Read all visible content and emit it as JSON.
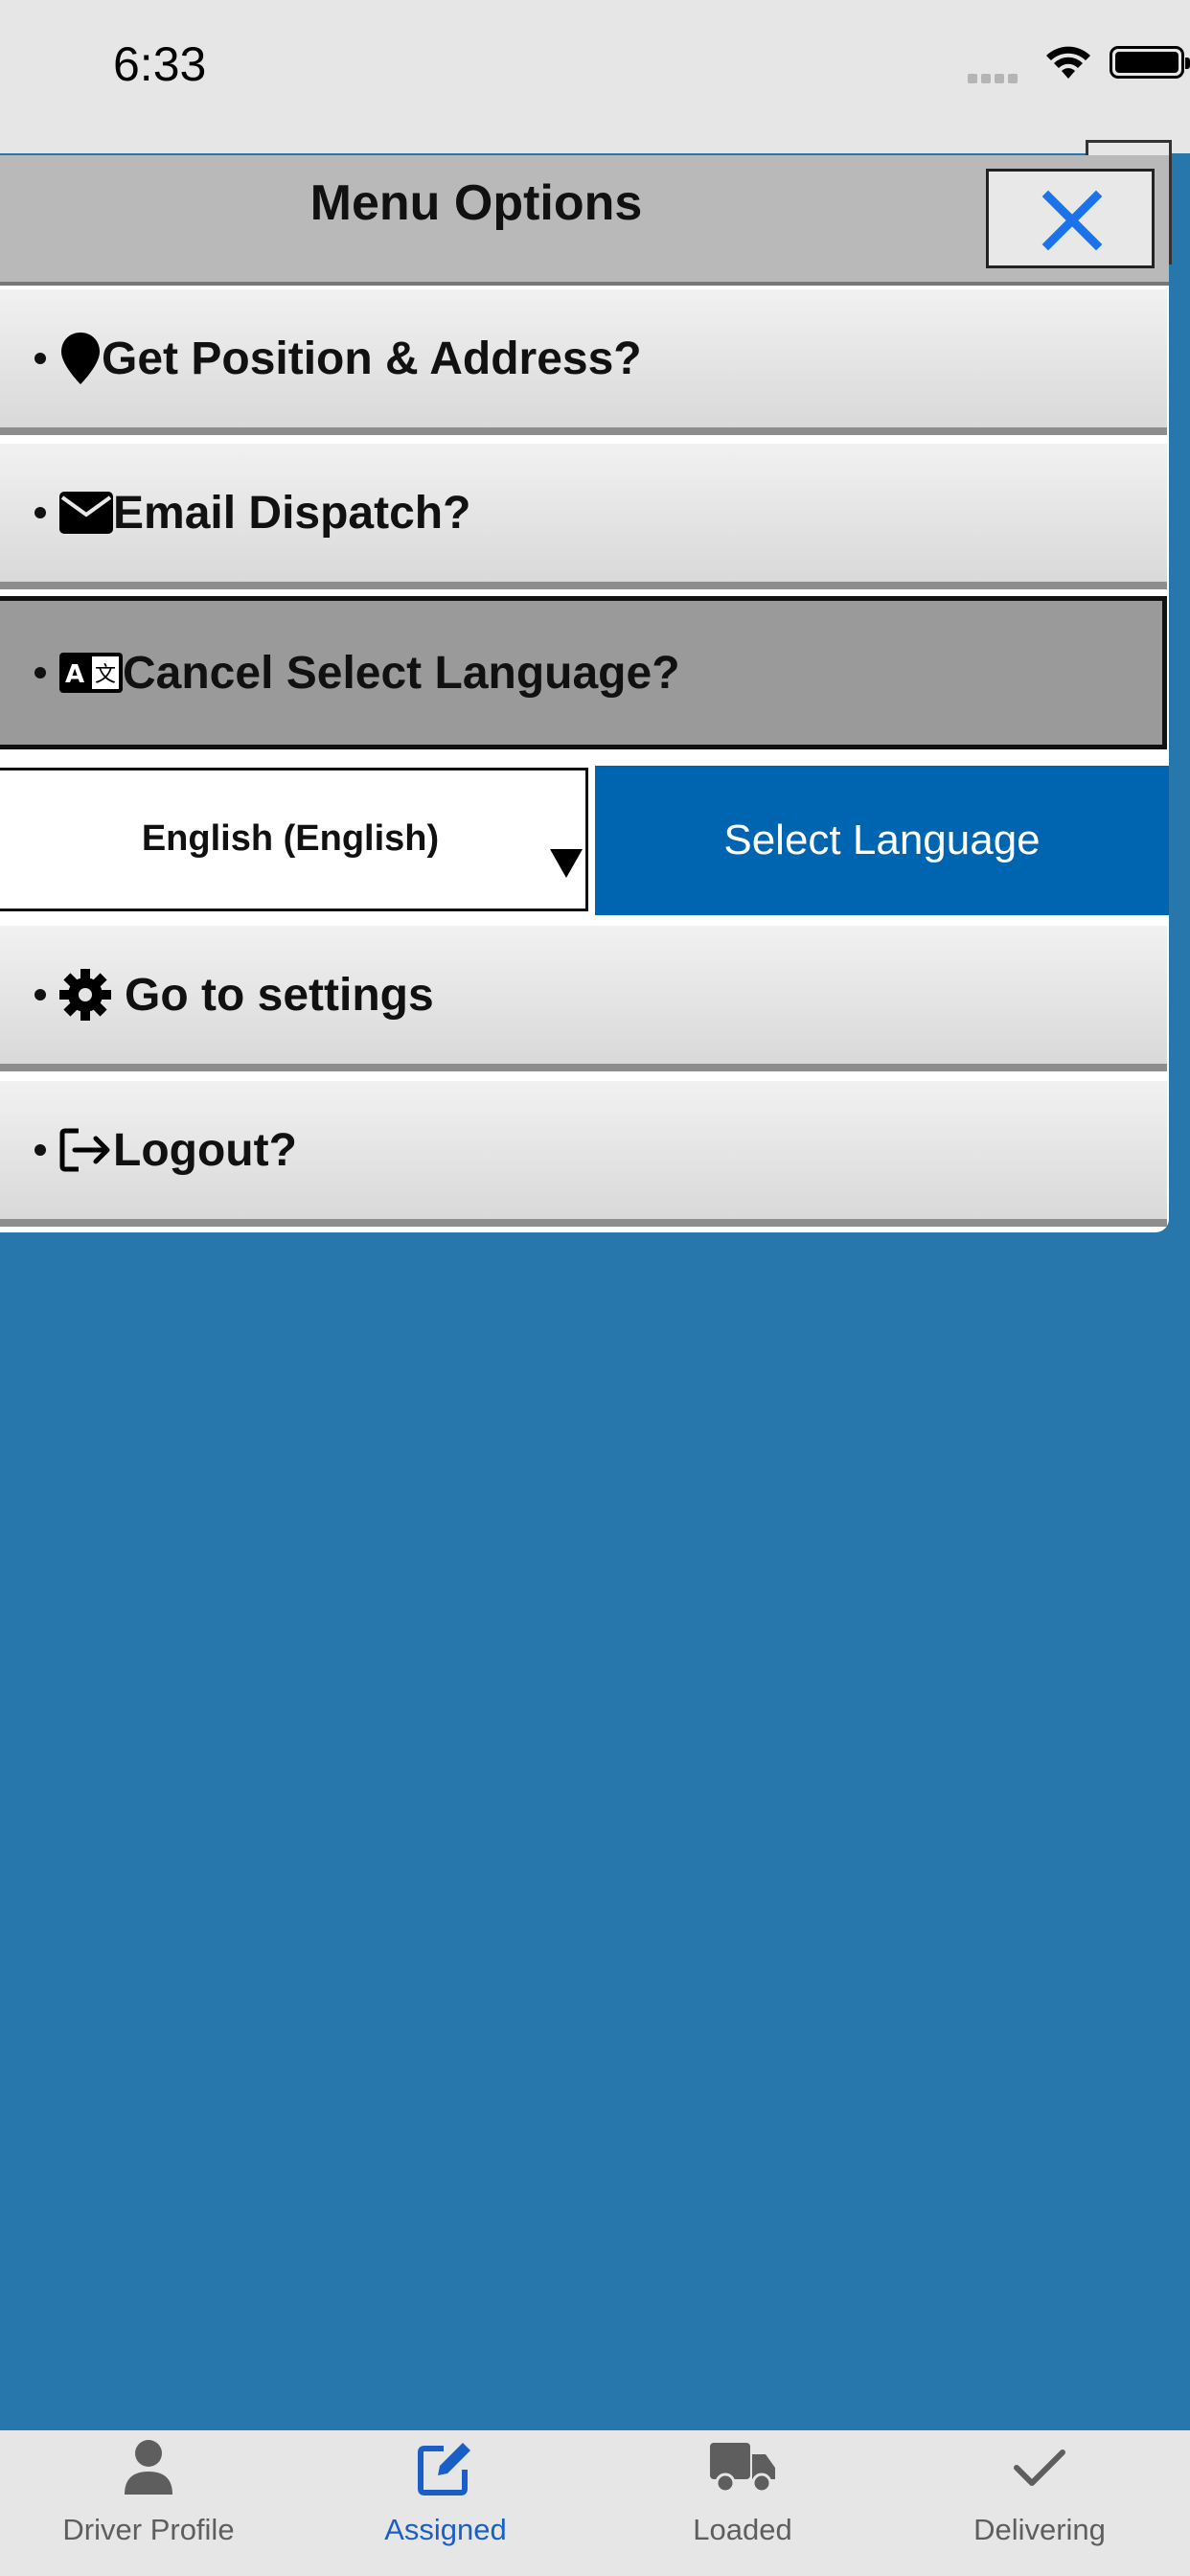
{
  "status_bar": {
    "time": "6:33"
  },
  "menu": {
    "title": "Menu Options",
    "items": [
      {
        "label": "Get Position & Address?",
        "icon": "map-pin-icon"
      },
      {
        "label": "Email Dispatch?",
        "icon": "envelope-icon"
      },
      {
        "label": "Cancel Select Language?",
        "icon": "translate-icon"
      },
      {
        "label": "Go to settings",
        "icon": "gear-icon"
      },
      {
        "label": "Logout?",
        "icon": "logout-icon"
      }
    ],
    "language": {
      "selected": "English (English)",
      "button_label": "Select Language"
    }
  },
  "tabbar": {
    "tabs": [
      {
        "label": "Driver Profile",
        "icon": "person-icon"
      },
      {
        "label": "Assigned",
        "icon": "edit-icon",
        "active": true
      },
      {
        "label": "Loaded",
        "icon": "truck-icon"
      },
      {
        "label": "Delivering",
        "icon": "checkmark-icon"
      }
    ]
  },
  "colors": {
    "background": "#2777ac",
    "accent_blue": "#0065b0",
    "close_icon": "#1a73e8",
    "tab_active": "#1a5fc8"
  }
}
